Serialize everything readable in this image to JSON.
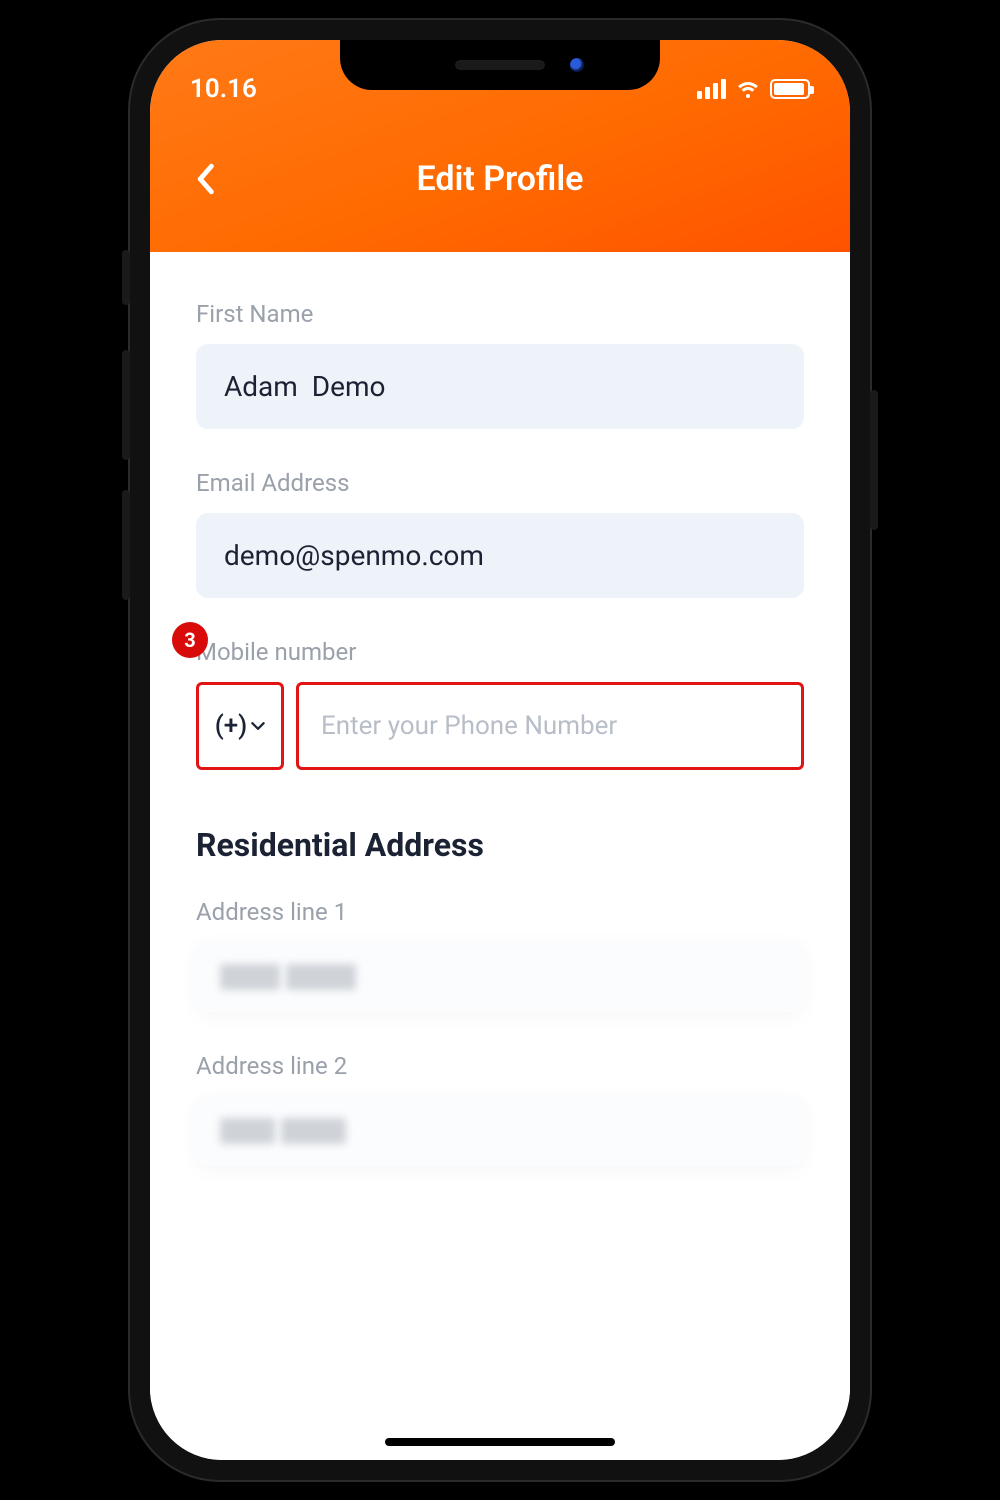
{
  "statusbar": {
    "time": "10.16"
  },
  "page": {
    "title": "Edit Profile"
  },
  "annotation": {
    "step": "3"
  },
  "form": {
    "firstName": {
      "label": "First Name",
      "value": "Adam  Demo"
    },
    "email": {
      "label": "Email Address",
      "value": "demo@spenmo.com"
    },
    "mobile": {
      "label": "Mobile number",
      "cc": "(+)",
      "placeholder": "Enter your Phone Number",
      "value": ""
    }
  },
  "address": {
    "section": "Residential Address",
    "line1Label": "Address line 1",
    "line2Label": "Address line 2"
  }
}
